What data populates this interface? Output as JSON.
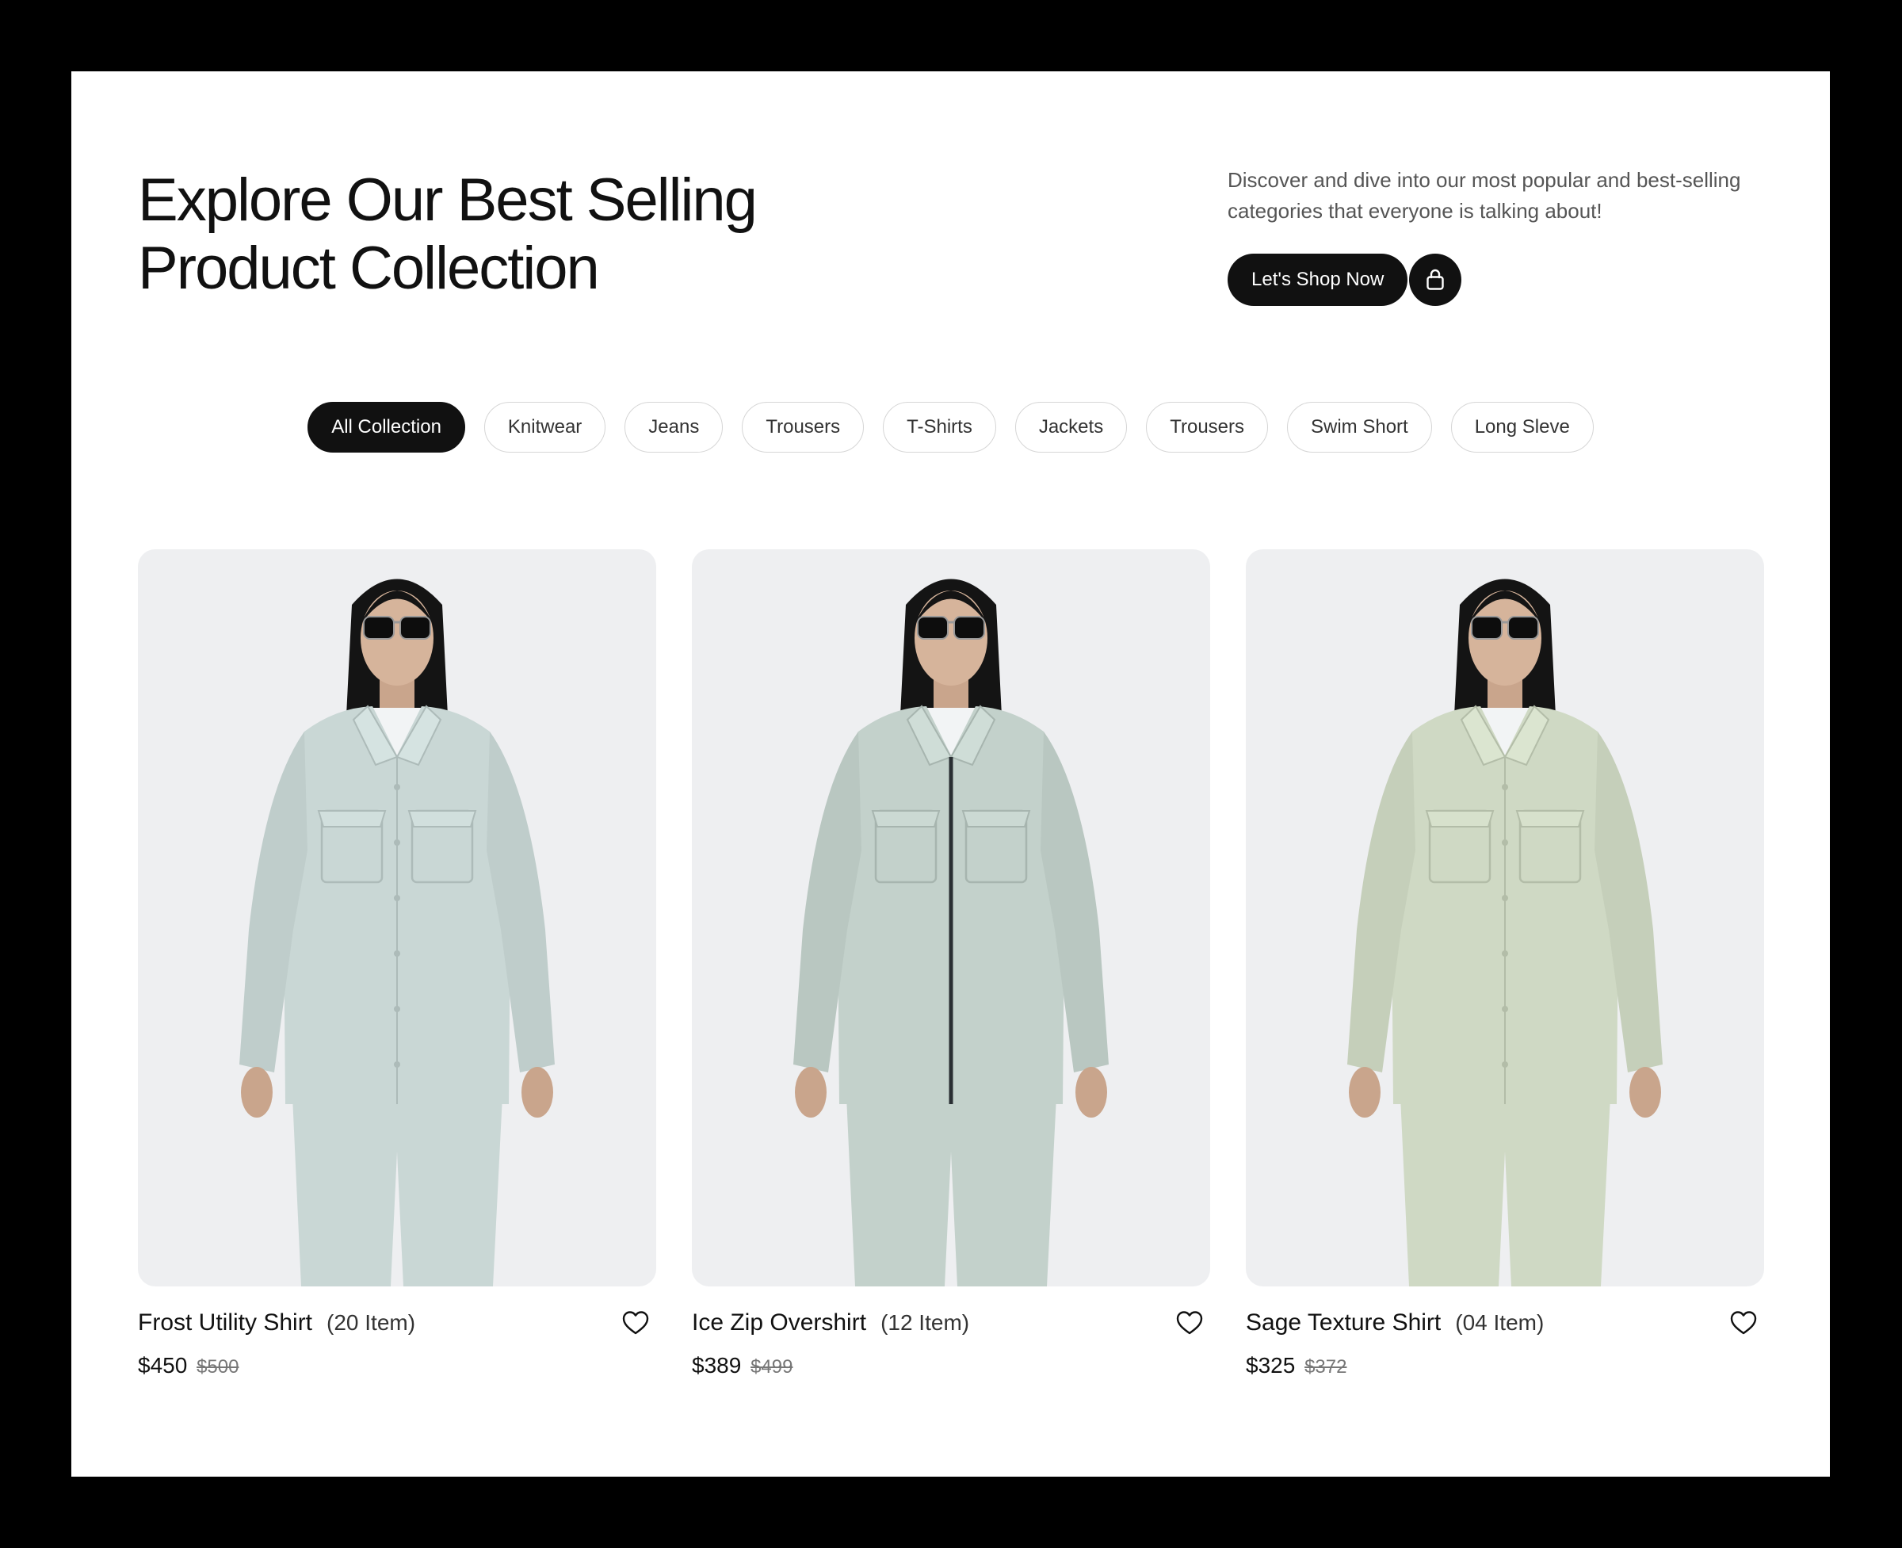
{
  "hero": {
    "title_line1": "Explore Our Best Selling",
    "title_line2": "Product Collection",
    "description": "Discover and dive into our most popular and best-selling categories that everyone is talking about!",
    "cta_label": "Let's Shop Now",
    "cta_icon": "shopping-bag-icon"
  },
  "filters": [
    {
      "label": "All Collection",
      "active": true
    },
    {
      "label": "Knitwear",
      "active": false
    },
    {
      "label": "Jeans",
      "active": false
    },
    {
      "label": "Trousers",
      "active": false
    },
    {
      "label": "T-Shirts",
      "active": false
    },
    {
      "label": "Jackets",
      "active": false
    },
    {
      "label": "Trousers",
      "active": false
    },
    {
      "label": "Swim Short",
      "active": false
    },
    {
      "label": "Long Sleve",
      "active": false
    }
  ],
  "products": [
    {
      "name": "Frost Utility Shirt",
      "count": "(20 Item)",
      "price": "$450",
      "old_price": "$500",
      "garment_color": "#c9d7d5",
      "icon": "heart-icon"
    },
    {
      "name": "Ice Zip Overshirt",
      "count": "(12 Item)",
      "price": "$389",
      "old_price": "$499",
      "garment_color": "#c3d1cb",
      "icon": "heart-icon"
    },
    {
      "name": "Sage Texture Shirt",
      "count": "(04 Item)",
      "price": "$325",
      "old_price": "$372",
      "garment_color": "#cfd9c4",
      "icon": "heart-icon"
    }
  ],
  "colors": {
    "accent": "#111111",
    "card_background": "#eeeff1",
    "page_background": "#ffffff"
  }
}
